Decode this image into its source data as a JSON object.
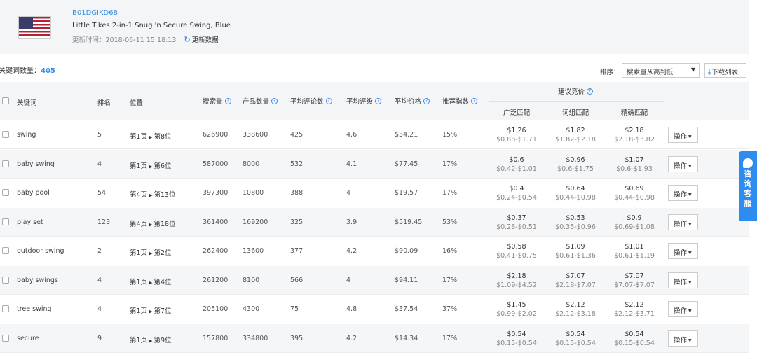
{
  "product": {
    "asin": "B01DGIKD68",
    "title": "Little Tikes 2-in-1 Snug 'n Secure Swing, Blue",
    "update_time": "更新时间：2018-06-11 15:18:13",
    "refresh_label": "更新数据",
    "flag_icon": "us-flag-icon"
  },
  "toolbar": {
    "keyword_count_label": "关键词数量：",
    "keyword_count": "405",
    "sort_label": "排序：",
    "sort_value": "搜索量从高到低",
    "download_label": "下载列表"
  },
  "table": {
    "headers": {
      "keyword": "关键词",
      "rank": "排名",
      "position": "位置",
      "search_volume": "搜索量",
      "product_count": "产品数量",
      "avg_reviews": "平均评论数",
      "avg_rating": "平均评级",
      "avg_price": "平均价格",
      "recommend_index": "推荐指数",
      "suggested_bid": "建议竞价",
      "broad_match": "广泛匹配",
      "phrase_match": "词组匹配",
      "exact_match": "精确匹配"
    },
    "operation_label": "操作",
    "rows": [
      {
        "keyword": "swing",
        "rank": "5",
        "page": "第1页",
        "slot": "第8位",
        "search_volume": "626900",
        "product_count": "338600",
        "avg_reviews": "425",
        "avg_rating": "4.6",
        "avg_price": "$34.21",
        "recommend_index": "15%",
        "broad": "$1.26",
        "broad_range": "$0.88-$1.71",
        "phrase": "$1.82",
        "phrase_range": "$1.82-$2.18",
        "exact": "$2.18",
        "exact_range": "$2.18-$3.82"
      },
      {
        "keyword": "baby swing",
        "rank": "4",
        "page": "第1页",
        "slot": "第6位",
        "search_volume": "587000",
        "product_count": "8000",
        "avg_reviews": "532",
        "avg_rating": "4.1",
        "avg_price": "$77.45",
        "recommend_index": "17%",
        "broad": "$0.6",
        "broad_range": "$0.42-$1.01",
        "phrase": "$0.96",
        "phrase_range": "$0.6-$1.75",
        "exact": "$1.07",
        "exact_range": "$0.6-$1.93"
      },
      {
        "keyword": "baby pool",
        "rank": "54",
        "page": "第4页",
        "slot": "第13位",
        "search_volume": "397300",
        "product_count": "10800",
        "avg_reviews": "388",
        "avg_rating": "4",
        "avg_price": "$19.57",
        "recommend_index": "17%",
        "broad": "$0.4",
        "broad_range": "$0.24-$0.54",
        "phrase": "$0.64",
        "phrase_range": "$0.44-$0.98",
        "exact": "$0.69",
        "exact_range": "$0.44-$0.98"
      },
      {
        "keyword": "play set",
        "rank": "123",
        "page": "第4页",
        "slot": "第18位",
        "search_volume": "361400",
        "product_count": "169200",
        "avg_reviews": "325",
        "avg_rating": "3.9",
        "avg_price": "$519.45",
        "recommend_index": "53%",
        "broad": "$0.37",
        "broad_range": "$0.28-$0.51",
        "phrase": "$0.53",
        "phrase_range": "$0.35-$0.96",
        "exact": "$0.9",
        "exact_range": "$0.69-$1.08"
      },
      {
        "keyword": "outdoor swing",
        "rank": "2",
        "page": "第1页",
        "slot": "第2位",
        "search_volume": "262400",
        "product_count": "13600",
        "avg_reviews": "377",
        "avg_rating": "4.2",
        "avg_price": "$90.09",
        "recommend_index": "16%",
        "broad": "$0.58",
        "broad_range": "$0.41-$0.75",
        "phrase": "$1.09",
        "phrase_range": "$0.61-$1.36",
        "exact": "$1.01",
        "exact_range": "$0.61-$1.19"
      },
      {
        "keyword": "baby swings",
        "rank": "4",
        "page": "第1页",
        "slot": "第4位",
        "search_volume": "261200",
        "product_count": "8100",
        "avg_reviews": "566",
        "avg_rating": "4",
        "avg_price": "$94.11",
        "recommend_index": "17%",
        "broad": "$2.18",
        "broad_range": "$1.09-$4.52",
        "phrase": "$7.07",
        "phrase_range": "$2.18-$7.07",
        "exact": "$7.07",
        "exact_range": "$7.07-$7.07"
      },
      {
        "keyword": "tree swing",
        "rank": "4",
        "page": "第1页",
        "slot": "第7位",
        "search_volume": "205100",
        "product_count": "4300",
        "avg_reviews": "75",
        "avg_rating": "4.8",
        "avg_price": "$37.54",
        "recommend_index": "37%",
        "broad": "$1.45",
        "broad_range": "$0.99-$2.02",
        "phrase": "$2.12",
        "phrase_range": "$2.12-$3.18",
        "exact": "$2.12",
        "exact_range": "$2.12-$3.71"
      },
      {
        "keyword": "secure",
        "rank": "9",
        "page": "第1页",
        "slot": "第9位",
        "search_volume": "157800",
        "product_count": "334800",
        "avg_reviews": "395",
        "avg_rating": "4.2",
        "avg_price": "$14.34",
        "recommend_index": "17%",
        "broad": "$0.54",
        "broad_range": "$0.15-$0.54",
        "phrase": "$0.54",
        "phrase_range": "$0.15-$0.54",
        "exact": "$0.54",
        "exact_range": "$0.15-$0.54"
      }
    ]
  },
  "side_service": {
    "label": "咨询客服",
    "icon": "chat-bubble-icon",
    "color": "#2d8cf0"
  },
  "colors": {
    "accent": "#3a8ee6",
    "header_bg": "#f4f5f7"
  }
}
